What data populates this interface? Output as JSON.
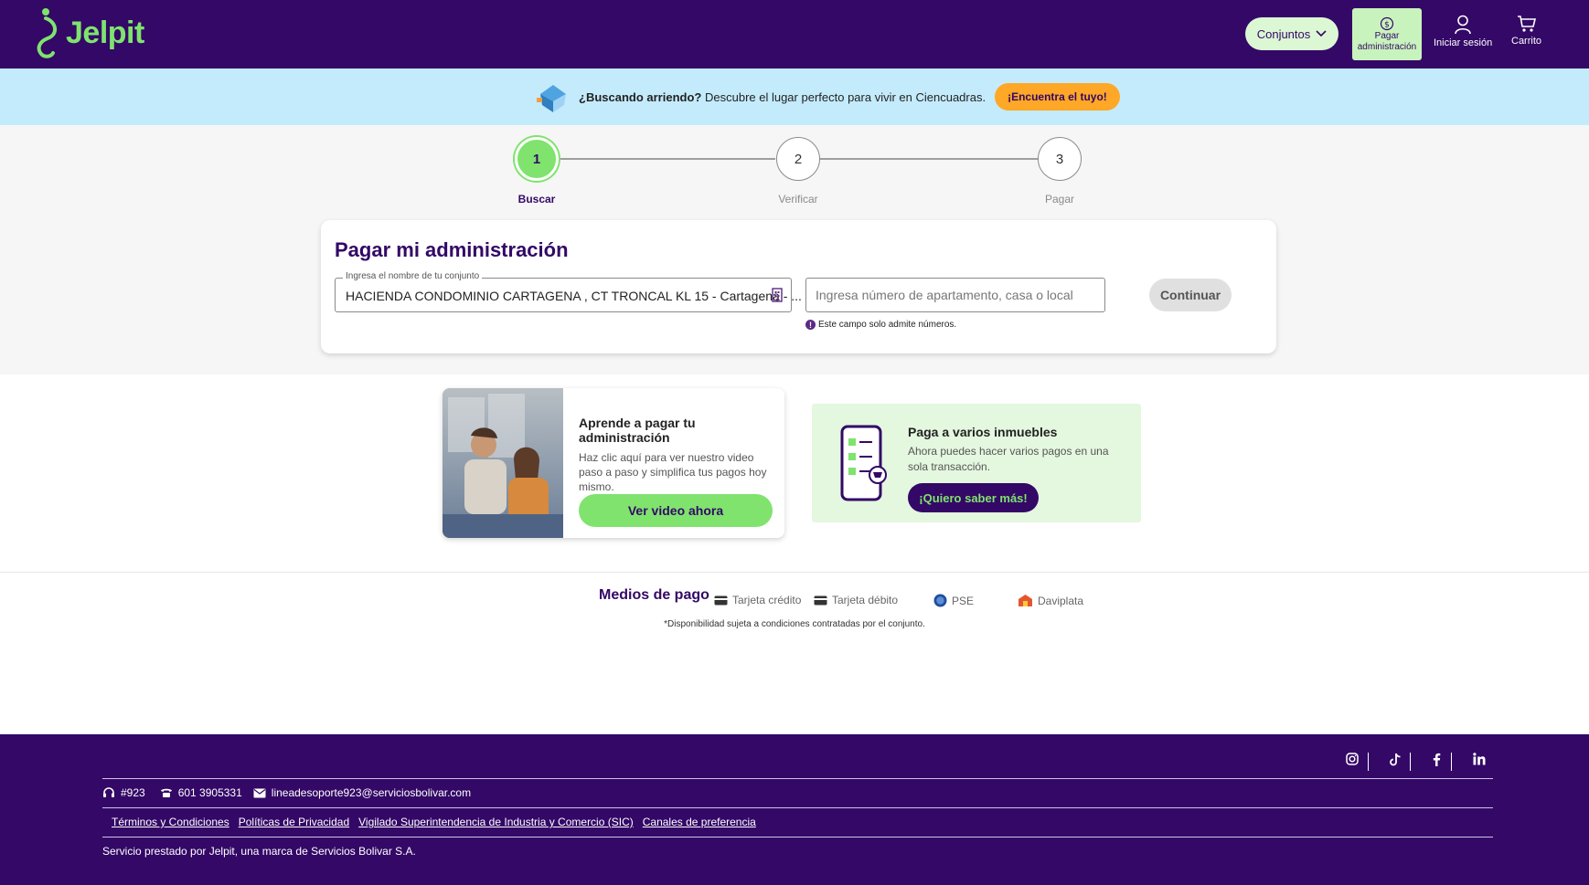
{
  "header": {
    "logo_text": "Jelpit",
    "conjuntos_label": "Conjuntos",
    "pagar_label_line1": "Pagar",
    "pagar_label_line2": "administración",
    "login_label": "Iniciar sesión",
    "cart_label": "Carrito"
  },
  "banner": {
    "bold_text": "¿Buscando arriendo?",
    "text": "Descubre el lugar perfecto para vivir en Ciencuadras.",
    "button_label": "¡Encuentra el tuyo!"
  },
  "stepper": {
    "steps": [
      {
        "number": "1",
        "label": "Buscar"
      },
      {
        "number": "2",
        "label": "Verificar"
      },
      {
        "number": "3",
        "label": "Pagar"
      }
    ]
  },
  "form": {
    "title": "Pagar mi administración",
    "conjunto_label": "Ingresa el nombre de tu conjunto",
    "conjunto_value": "HACIENDA CONDOMINIO CARTAGENA , CT TRONCAL KL 15 - Cartagena - ...",
    "unit_placeholder": "Ingresa número de apartamento, casa o local",
    "hint": "Este campo solo admite números.",
    "continue_label": "Continuar"
  },
  "promo_video": {
    "title": "Aprende a pagar tu administración",
    "text": "Haz clic aquí para ver nuestro video paso a paso y simplifica tus pagos hoy mismo.",
    "button_label": "Ver video ahora"
  },
  "promo_multi": {
    "title": "Paga a varios inmuebles",
    "text": "Ahora puedes hacer varios pagos en una sola transacción.",
    "button_label": "¡Quiero saber más!"
  },
  "payment_methods": {
    "title": "Medios de pago",
    "items": [
      "Tarjeta crédito",
      "Tarjeta débito",
      "PSE",
      "Daviplata"
    ],
    "note": "*Disponibilidad sujeta a condiciones contratadas por el conjunto."
  },
  "footer": {
    "shortcode": "#923",
    "phone": "601 3905331",
    "email": "lineadesoporte923@serviciosbolivar.com",
    "links": [
      "Términos y Condiciones",
      "Políticas de Privacidad",
      "Vigilado Superintendencia de Industria y Comercio (SIC)",
      "Canales de preferencia"
    ],
    "copyright": "Servicio prestado por Jelpit, una marca de Servicios Bolivar S.A."
  },
  "colors": {
    "brand_purple": "#330866",
    "brand_green": "#7fe36e",
    "banner_blue": "#c4ebfc",
    "cta_orange": "#ffa726"
  }
}
